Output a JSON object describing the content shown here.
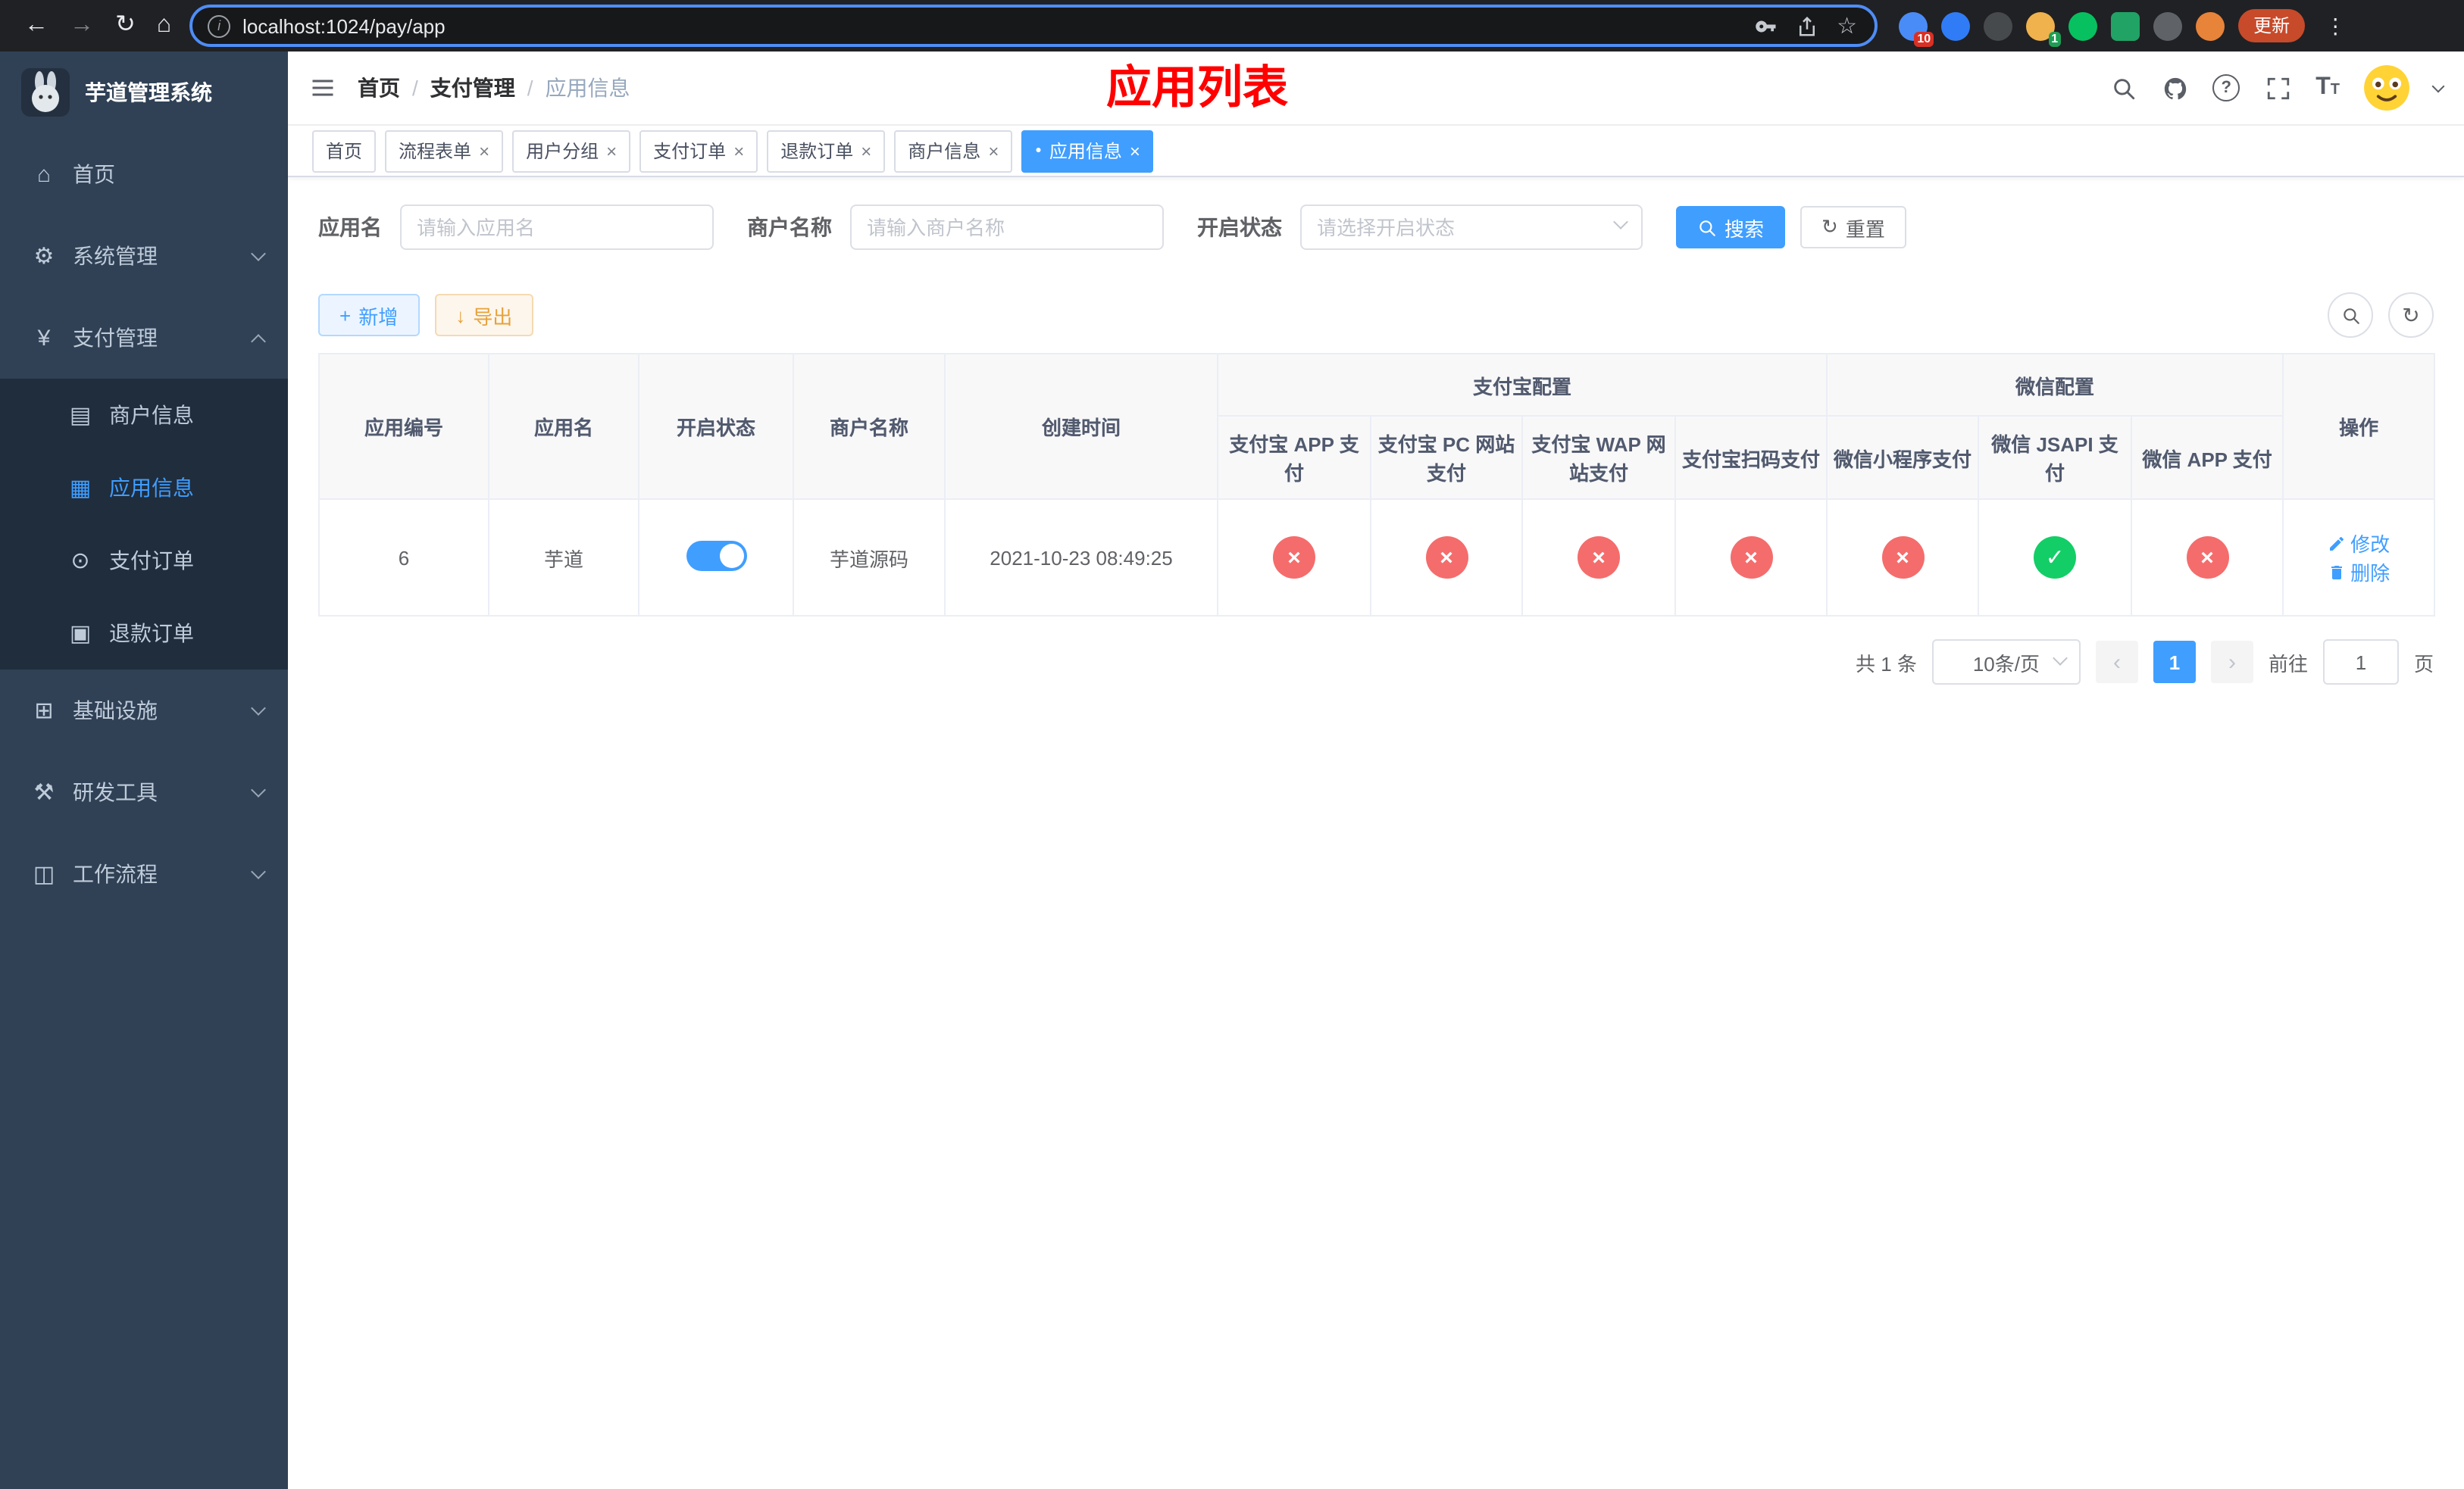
{
  "browser": {
    "url": "localhost:1024/pay/app",
    "update_label": "更新",
    "ext_badges": {
      "first": "10",
      "second": "1"
    }
  },
  "icons": {
    "back": "←",
    "forward": "→",
    "reload": "↻",
    "home": "⌂",
    "info": "i",
    "star": "☆",
    "kebab": "⋮",
    "cross": "×",
    "check": "✓",
    "plus": "+",
    "download": "↓",
    "refresh": "↻",
    "close": "×",
    "dot": "●",
    "question": "?",
    "text_size": "T"
  },
  "sidebar": {
    "title": "芋道管理系统",
    "items": [
      {
        "label": "首页",
        "icon": "⌂"
      },
      {
        "label": "系统管理",
        "icon": "⚙"
      },
      {
        "label": "支付管理",
        "icon": "¥"
      },
      {
        "label": "基础设施",
        "icon": "⊞"
      },
      {
        "label": "研发工具",
        "icon": "⚒"
      },
      {
        "label": "工作流程",
        "icon": "◫"
      }
    ],
    "pay_children": [
      {
        "label": "商户信息",
        "icon": "▤"
      },
      {
        "label": "应用信息",
        "icon": "▦"
      },
      {
        "label": "支付订单",
        "icon": "⊙"
      },
      {
        "label": "退款订单",
        "icon": "▣"
      }
    ]
  },
  "navbar": {
    "breadcrumb": [
      "首页",
      "支付管理",
      "应用信息"
    ],
    "separator": "/",
    "overlay_title": "应用列表"
  },
  "tabs": [
    {
      "label": "首页"
    },
    {
      "label": "流程表单"
    },
    {
      "label": "用户分组"
    },
    {
      "label": "支付订单"
    },
    {
      "label": "退款订单"
    },
    {
      "label": "商户信息"
    },
    {
      "label": "应用信息"
    }
  ],
  "filters": {
    "app_name_label": "应用名",
    "app_name_placeholder": "请输入应用名",
    "merchant_label": "商户名称",
    "merchant_placeholder": "请输入商户名称",
    "status_label": "开启状态",
    "status_placeholder": "请选择开启状态",
    "search_label": "搜索",
    "reset_label": "重置"
  },
  "toolbar": {
    "add_label": "新增",
    "export_label": "导出"
  },
  "table": {
    "group_headers": {
      "alipay": "支付宝配置",
      "wechat": "微信配置"
    },
    "columns": {
      "app_id": "应用编号",
      "app_name": "应用名",
      "status": "开启状态",
      "merchant": "商户名称",
      "created": "创建时间",
      "alipay_app": "支付宝 APP 支付",
      "alipay_pc": "支付宝 PC 网站支付",
      "alipay_wap": "支付宝 WAP 网站支付",
      "alipay_qr": "支付宝扫码支付",
      "wx_mini": "微信小程序支付",
      "wx_jsapi": "微信 JSAPI 支付",
      "wx_app": "微信 APP 支付",
      "actions": "操作"
    },
    "rows": [
      {
        "app_id": "6",
        "app_name": "芋道",
        "status_on": true,
        "merchant": "芋道源码",
        "created": "2021-10-23 08:49:25",
        "alipay_app": "disabled",
        "alipay_pc": "disabled",
        "alipay_wap": "disabled",
        "alipay_qr": "disabled",
        "wx_mini": "disabled",
        "wx_jsapi": "enabled",
        "wx_app": "disabled",
        "edit_label": "修改",
        "delete_label": "删除"
      }
    ]
  },
  "pagination": {
    "total_text": "共 1 条",
    "page_size_text": "10条/页",
    "current_page": "1",
    "goto_prefix": "前往",
    "goto_value": "1",
    "goto_suffix": "页"
  },
  "colors": {
    "accent": "#409eff",
    "danger": "#f56c6c",
    "success": "#13ce66",
    "warning": "#e6a23c",
    "sidebar_bg": "#304156",
    "submenu_bg": "#1f2d3d",
    "title_red": "#ff0000"
  }
}
